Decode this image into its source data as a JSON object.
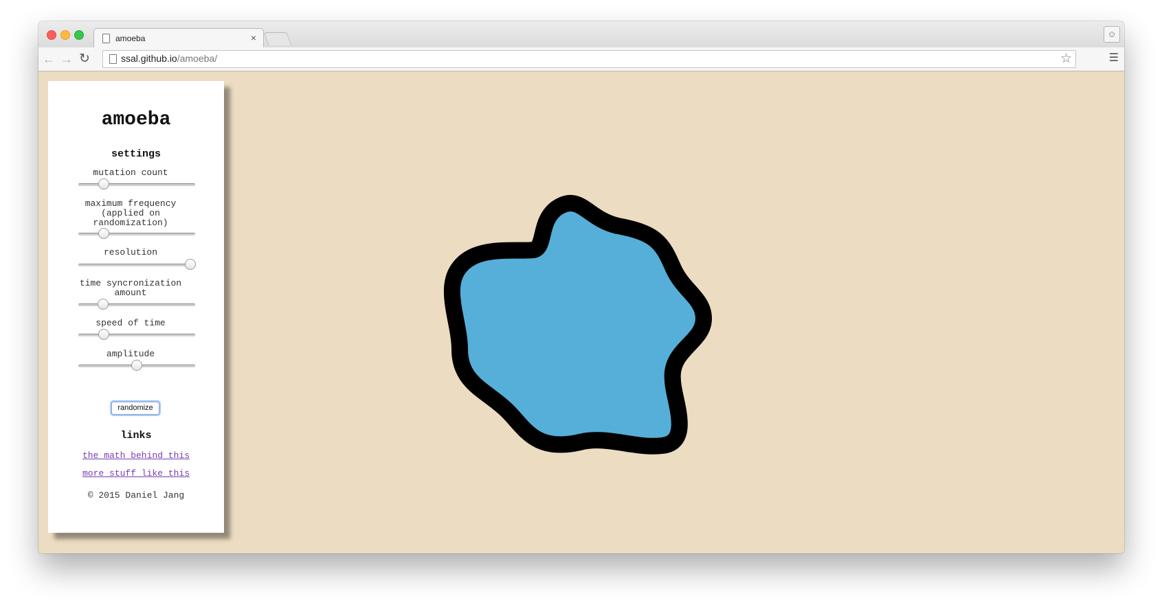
{
  "browser": {
    "tab_title": "amoeba",
    "tab_close": "×",
    "url_host": "ssal.github.io",
    "url_path": "/amoeba/",
    "icons": {
      "back": "back-arrow-icon",
      "forward": "forward-arrow-icon",
      "reload": "reload-icon",
      "star": "star-icon",
      "menu": "hamburger-menu-icon",
      "profile": "profile-icon"
    }
  },
  "panel": {
    "title": "amoeba",
    "settings_title": "settings",
    "settings": [
      {
        "label": "mutation count",
        "value_fraction": 0.22
      },
      {
        "label": "maximum frequency (applied on randomization)",
        "value_fraction": 0.22
      },
      {
        "label": "resolution",
        "value_fraction": 0.96
      },
      {
        "label": "time syncronization amount",
        "value_fraction": 0.21
      },
      {
        "label": "speed of time",
        "value_fraction": 0.22
      },
      {
        "label": "amplitude",
        "value_fraction": 0.5
      }
    ],
    "randomize_label": "randomize",
    "links_title": "links",
    "links": [
      "the math behind this",
      "more stuff like this"
    ],
    "copyright": "© 2015 Daniel Jang"
  },
  "colors": {
    "background": "#ecdcc1",
    "amoeba_fill": "#55afd8",
    "amoeba_outline": "#000000",
    "link": "#7a3bb8"
  }
}
